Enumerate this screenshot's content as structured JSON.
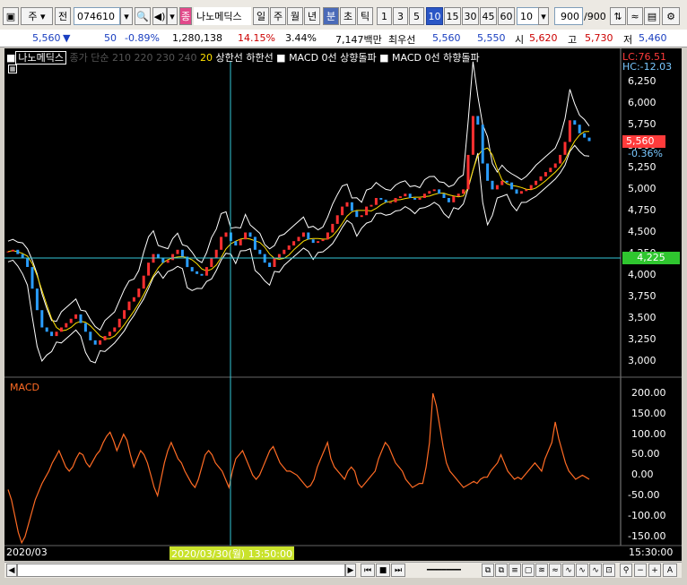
{
  "toolbar": {
    "market": "주",
    "prev": "전",
    "code": "074610",
    "stock_name": "나노메딕스",
    "period_buttons": [
      "일",
      "주",
      "월",
      "년"
    ],
    "unit_buttons": [
      "분",
      "초",
      "틱"
    ],
    "minute_buttons": [
      "1",
      "3",
      "5",
      "10",
      "15",
      "30",
      "45",
      "60"
    ],
    "count_value": "10",
    "range_value": "900",
    "range_total": "/900"
  },
  "info": {
    "price": "5,560",
    "arrow": "▼",
    "change": "50",
    "pct": "-0.89%",
    "volume": "1,280,138",
    "vol_ratio": "14.15%",
    "rate": "3.44%",
    "amount": "7,147백만",
    "quote_label": "최우선",
    "ask": "5,560",
    "bid": "5,550",
    "open_label": "시",
    "open": "5,620",
    "high_label": "고",
    "high": "5,730",
    "low_label": "저",
    "low": "5,460"
  },
  "legend": {
    "name": "나노메딕스",
    "ma": "종가 단순 210  220  230  240",
    "ma20": "20",
    "rest": " 상한선  하한선  ■ MACD 0선 상향돌파  ■ MACD 0선 하향돌파"
  },
  "price_panel": {
    "lc": "LC:76.51",
    "hc": "HC:-12.03",
    "y_ticks": [
      "6,250",
      "6,000",
      "5,750",
      "5,500",
      "5,250",
      "5,000",
      "4,750",
      "4,500",
      "4,250",
      "4,000",
      "3,750",
      "3,500",
      "3,250",
      "3,000"
    ],
    "current_price": "5,560",
    "current_pct": "-0.36%",
    "crosshair_price": "4,225"
  },
  "macd_panel": {
    "title": "MACD",
    "y_ticks": [
      "200.00",
      "150.00",
      "100.00",
      "50.00",
      "0.00",
      "-50.00",
      "-100.00",
      "-150.00"
    ]
  },
  "x_axis": {
    "start": "2020/03",
    "crosshair_label": "2020/03/30(월) 13:50:00",
    "end": "15:30:00"
  },
  "chart_data": {
    "type": "line",
    "macd": [
      -35,
      -60,
      -100,
      -140,
      -165,
      -150,
      -120,
      -90,
      -60,
      -40,
      -20,
      -5,
      10,
      30,
      45,
      60,
      40,
      20,
      10,
      20,
      40,
      55,
      50,
      30,
      20,
      35,
      50,
      60,
      80,
      95,
      105,
      85,
      60,
      80,
      100,
      85,
      50,
      20,
      40,
      60,
      50,
      30,
      0,
      -30,
      -50,
      -10,
      30,
      60,
      80,
      60,
      40,
      30,
      10,
      -5,
      -20,
      -30,
      -10,
      20,
      50,
      60,
      50,
      30,
      20,
      10,
      -10,
      -30,
      10,
      40,
      50,
      60,
      40,
      20,
      0,
      -10,
      0,
      20,
      40,
      60,
      70,
      50,
      30,
      20,
      10,
      10,
      5,
      0,
      -10,
      -20,
      -30,
      -25,
      -10,
      20,
      40,
      60,
      80,
      40,
      20,
      10,
      0,
      -10,
      10,
      20,
      10,
      -20,
      -30,
      -20,
      -10,
      0,
      10,
      40,
      60,
      80,
      70,
      50,
      30,
      20,
      10,
      -10,
      -20,
      -30,
      -25,
      -20,
      -20,
      20,
      80,
      200,
      170,
      120,
      70,
      30,
      10,
      0,
      -10,
      -20,
      -30,
      -25,
      -20,
      -15,
      -20,
      -10,
      -5,
      -5,
      10,
      20,
      30,
      50,
      30,
      10,
      0,
      -10,
      -5,
      -10,
      0,
      10,
      20,
      30,
      20,
      10,
      40,
      60,
      80,
      130,
      90,
      60,
      30,
      10,
      0,
      -10,
      -5,
      0,
      -5,
      -10
    ],
    "price_close": [
      4280,
      4300,
      4250,
      4200,
      4100,
      3850,
      3600,
      3400,
      3350,
      3300,
      3350,
      3400,
      3450,
      3500,
      3550,
      3450,
      3350,
      3250,
      3200,
      3250,
      3300,
      3350,
      3400,
      3500,
      3600,
      3700,
      3750,
      3850,
      4000,
      4150,
      4250,
      4200,
      4150,
      4180,
      4250,
      4300,
      4220,
      4100,
      4050,
      4020,
      4000,
      4100,
      4200,
      4300,
      4450,
      4500,
      4400,
      4350,
      4420,
      4500,
      4450,
      4300,
      4250,
      4150,
      4100,
      4200,
      4250,
      4300,
      4350,
      4400,
      4450,
      4500,
      4420,
      4380,
      4400,
      4420,
      4500,
      4600,
      4700,
      4800,
      4850,
      4750,
      4680,
      4700,
      4800,
      4820,
      4900,
      4880,
      4850,
      4850,
      4900,
      4920,
      4950,
      4900,
      4880,
      4900,
      4950,
      4980,
      5000,
      4950,
      4900,
      4850,
      4920,
      4950,
      5000,
      5400,
      5850,
      5750,
      5300,
      5100,
      5000,
      5050,
      5100,
      5080,
      5000,
      4950,
      4980,
      5000,
      5050,
      5100,
      5150,
      5200,
      5250,
      5300,
      5400,
      5550,
      5800,
      5750,
      5650,
      5600,
      5560
    ],
    "crosshair_index": 45
  }
}
